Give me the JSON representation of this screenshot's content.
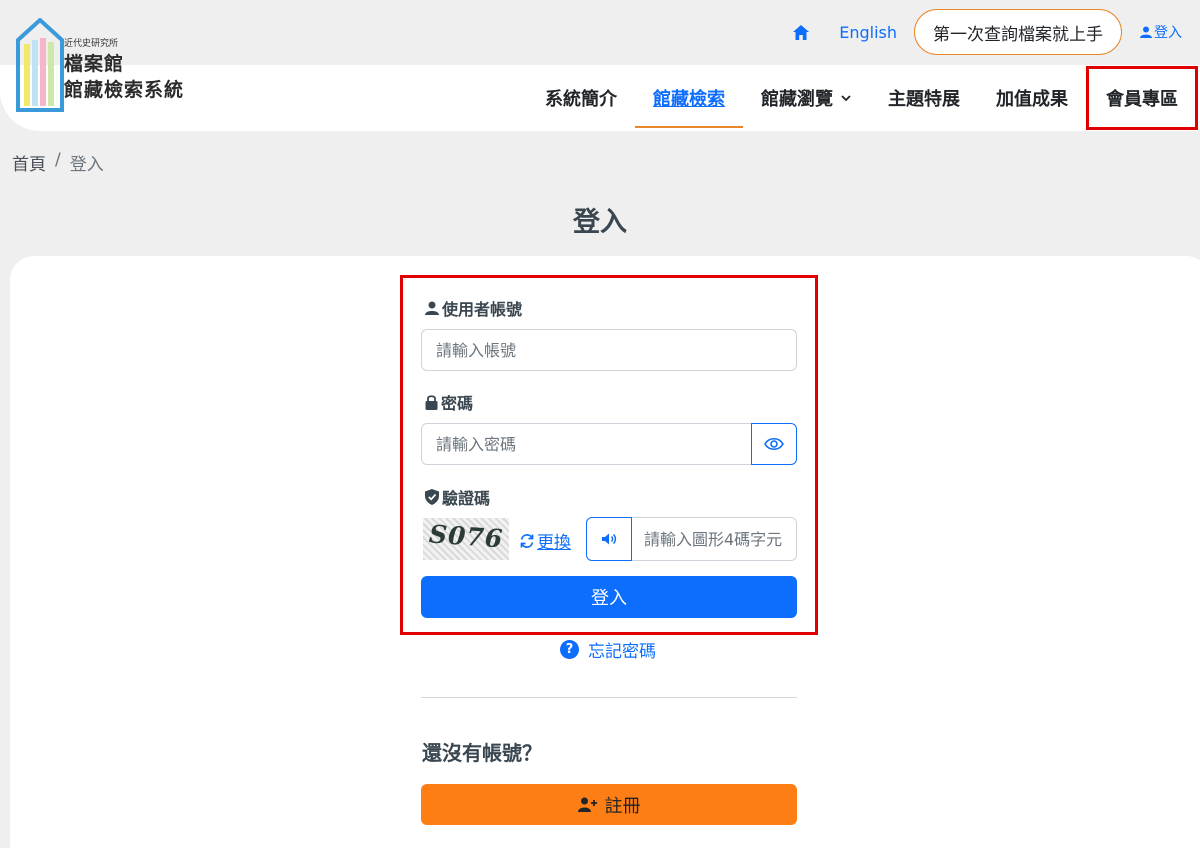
{
  "header": {
    "org_name": "近代史研究所",
    "logo_line1": "檔案館",
    "logo_line2": "館藏檢索系統",
    "language_link": "English",
    "guide_button": "第一次查詢檔案就上手",
    "login_link": "登入"
  },
  "nav": {
    "items": [
      {
        "label": "系統簡介"
      },
      {
        "label": "館藏檢索"
      },
      {
        "label": "館藏瀏覽"
      },
      {
        "label": "主題特展"
      },
      {
        "label": "加值成果"
      },
      {
        "label": "會員專區"
      }
    ],
    "active_index": 1
  },
  "breadcrumb": {
    "home": "首頁",
    "separator": "/",
    "current": "登入"
  },
  "page_title": "登入",
  "form": {
    "username_label": "使用者帳號",
    "username_placeholder": "請輸入帳號",
    "password_label": "密碼",
    "password_placeholder": "請輸入密碼",
    "captcha_label": "驗證碼",
    "captcha_text": "S076",
    "refresh_label": "更換",
    "captcha_placeholder": "請輸入圖形4碼字元",
    "submit_label": "登入"
  },
  "forgot_password": "忘記密碼",
  "register": {
    "prompt": "還沒有帳號？",
    "button_label": "註冊"
  },
  "colors": {
    "primary": "#0d6efd",
    "accent_orange": "#fd7e14",
    "highlight_red": "#e00000"
  }
}
